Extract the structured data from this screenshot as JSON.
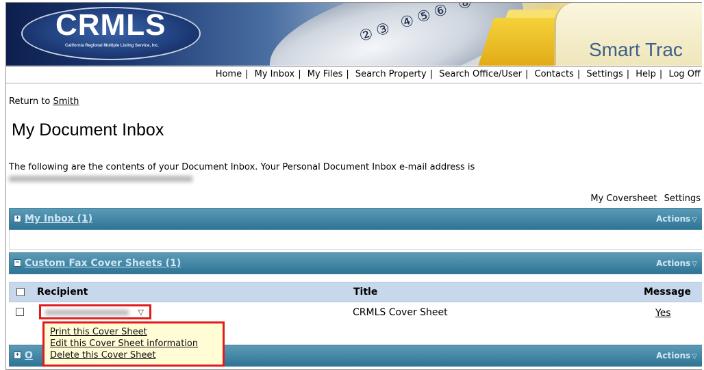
{
  "banner": {
    "logo_text": "CRMLS",
    "logo_subtitle": "California Regional Multiple Listing Service, Inc.",
    "product": "Smart Trac",
    "phone_keys": "②③ ④⑤⑥ ⑧"
  },
  "topnav": {
    "items": [
      "Home",
      "My Inbox",
      "My Files",
      "Search Property",
      "Search Office/User",
      "Contacts",
      "Settings",
      "Help",
      "Log Off"
    ],
    "separator": "|"
  },
  "return_link": {
    "prefix": "Return to",
    "name": "Smith"
  },
  "page_title": "My Document Inbox",
  "description": "The following are the contents of your Document Inbox. Your Personal Document Inbox e-mail address is",
  "top_links": {
    "coversheet": "My Coversheet",
    "settings": "Settings"
  },
  "sections": [
    {
      "label": "My Inbox (1)",
      "toggle": "+",
      "actions": "Actions",
      "actions_icon": "▽"
    },
    {
      "label": "Custom Fax Cover Sheets (1)",
      "toggle": "−",
      "actions": "Actions",
      "actions_icon": "▽"
    },
    {
      "label": "O",
      "toggle": "+",
      "actions": "Actions",
      "actions_icon": "▽"
    }
  ],
  "table": {
    "columns": [
      "Recipient",
      "Title",
      "Message"
    ],
    "rows": [
      {
        "recipient_dropdown_icon": "▽",
        "title": "CRMLS Cover Sheet",
        "message": "Yes"
      }
    ]
  },
  "context_menu": [
    "Print this Cover Sheet",
    "Edit this Cover Sheet information",
    "Delete this Cover Sheet"
  ],
  "colors": {
    "section_bar": "#3d84a6",
    "table_header": "#c7d7ec",
    "highlight": "#e01b1b",
    "menu_bg": "#fffcd6"
  }
}
